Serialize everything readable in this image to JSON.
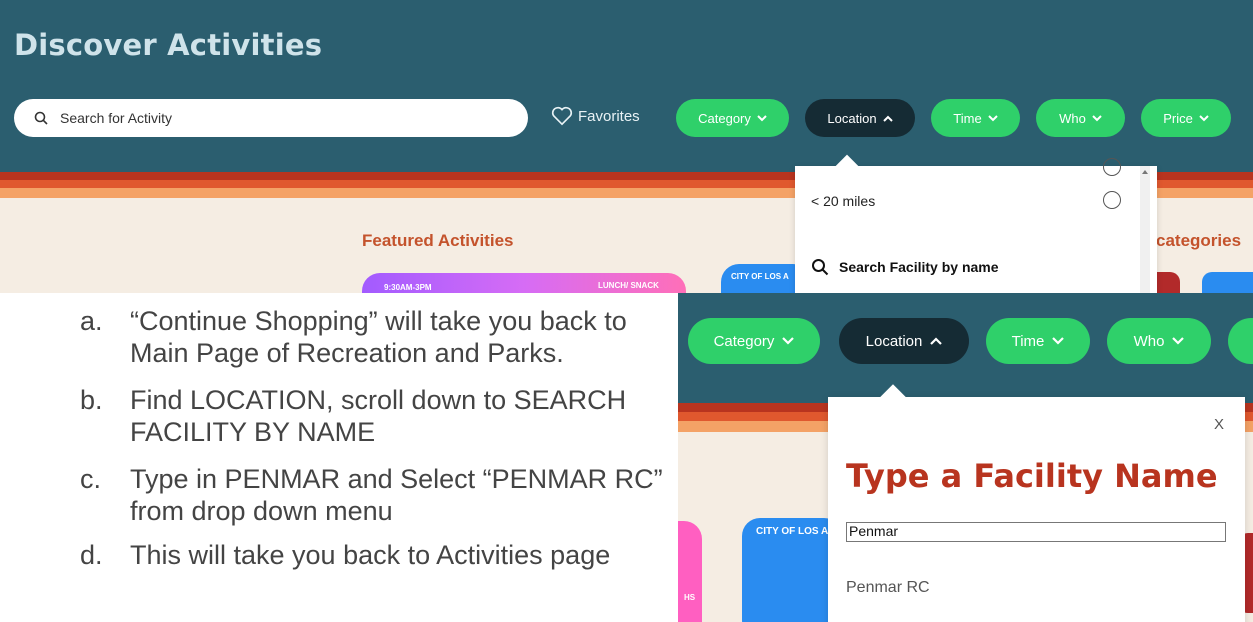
{
  "top": {
    "page_title": "Discover Activities",
    "search_placeholder": "Search for Activity",
    "favorites_label": "Favorites",
    "filters": {
      "category": "Category",
      "location": "Location",
      "time": "Time",
      "who": "Who",
      "price": "Price"
    },
    "dropdown": {
      "distance_option": "< 20 miles",
      "search_facility": "Search Facility by name"
    },
    "featured_heading": "Featured Activities",
    "categories_heading": "categories",
    "card_labels": [
      "9:30AM-3PM",
      "LUNCH/ SNACK",
      "CITY OF LOS A"
    ]
  },
  "instructions": [
    {
      "letter": "a.",
      "text": "“Continue Shopping” will take you back to Main Page of Recreation and Parks."
    },
    {
      "letter": "b.",
      "text": "Find LOCATION, scroll down to SEARCH FACILITY BY NAME"
    },
    {
      "letter": "c.",
      "text": "Type in PENMAR and Select “PENMAR RC” from drop down menu"
    },
    {
      "letter": "d.",
      "text": "This will take you back to Activities page"
    }
  ],
  "bottom": {
    "filters": {
      "category": "Category",
      "location": "Location",
      "time": "Time",
      "who": "Who"
    },
    "modal": {
      "close_label": "X",
      "title": "Type a Facility Name",
      "input_value": "Penmar",
      "suggestion": "Penmar RC"
    },
    "card_labels": [
      "CITY OF LOS A",
      "HS"
    ]
  },
  "colors": {
    "header_teal": "#2b5e6f",
    "pill_green": "#2fd06a",
    "pill_dark": "#152b34",
    "accent_orange": "#c4532c",
    "background_cream": "#f5ede3"
  }
}
